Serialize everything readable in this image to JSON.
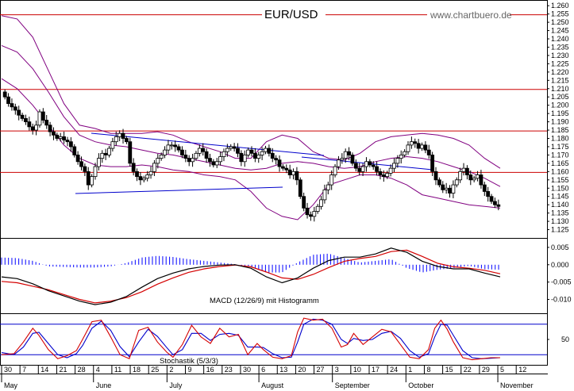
{
  "chart_data": [
    {
      "type": "candlestick",
      "title": "EUR/USD",
      "source": "www.chartbuero.de",
      "ylim": [
        1.12,
        1.262
      ],
      "yticks": [
        1.125,
        1.13,
        1.135,
        1.14,
        1.145,
        1.15,
        1.155,
        1.16,
        1.165,
        1.17,
        1.175,
        1.18,
        1.185,
        1.19,
        1.195,
        1.2,
        1.205,
        1.21,
        1.215,
        1.22,
        1.225,
        1.23,
        1.235,
        1.24,
        1.245,
        1.25,
        1.255,
        1.26
      ],
      "ytick_labels": [
        "1.125",
        "1.130",
        "1.135",
        "1.140",
        "1.145",
        "1.150",
        "1.155",
        "1.160",
        "1.165",
        "1.170",
        "1.175",
        "1.180",
        "1.185",
        "1.190",
        "1.195",
        "1.200",
        "1.205",
        "1.210",
        "1.215",
        "1.220",
        "1.225",
        "1.230",
        "1.235",
        "1.240",
        "1.245",
        "1.250",
        "1.255",
        "1.260"
      ],
      "horizontal_levels": [
        1.2545,
        1.2095,
        1.1845,
        1.1595
      ],
      "closes": [
        1.205,
        1.201,
        1.199,
        1.197,
        1.194,
        1.192,
        1.19,
        1.187,
        1.185,
        1.188,
        1.196,
        1.191,
        1.188,
        1.184,
        1.182,
        1.18,
        1.181,
        1.179,
        1.178,
        1.175,
        1.17,
        1.166,
        1.163,
        1.16,
        1.152,
        1.157,
        1.163,
        1.168,
        1.171,
        1.17,
        1.174,
        1.178,
        1.181,
        1.183,
        1.18,
        1.178,
        1.165,
        1.16,
        1.157,
        1.155,
        1.156,
        1.158,
        1.16,
        1.165,
        1.168,
        1.17,
        1.173,
        1.176,
        1.176,
        1.175,
        1.173,
        1.17,
        1.168,
        1.166,
        1.168,
        1.171,
        1.174,
        1.172,
        1.168,
        1.166,
        1.164,
        1.166,
        1.169,
        1.172,
        1.174,
        1.175,
        1.174,
        1.171,
        1.166,
        1.17,
        1.173,
        1.171,
        1.168,
        1.17,
        1.172,
        1.174,
        1.171,
        1.168,
        1.167,
        1.163,
        1.162,
        1.161,
        1.158,
        1.16,
        1.155,
        1.145,
        1.138,
        1.134,
        1.133,
        1.136,
        1.139,
        1.143,
        1.149,
        1.152,
        1.158,
        1.163,
        1.167,
        1.168,
        1.172,
        1.17,
        1.165,
        1.162,
        1.16,
        1.163,
        1.166,
        1.164,
        1.163,
        1.16,
        1.158,
        1.157,
        1.159,
        1.162,
        1.165,
        1.168,
        1.17,
        1.172,
        1.176,
        1.178,
        1.177,
        1.174,
        1.176,
        1.173,
        1.17,
        1.16,
        1.155,
        1.152,
        1.149,
        1.15,
        1.147,
        1.152,
        1.155,
        1.16,
        1.162,
        1.158,
        1.155,
        1.156,
        1.158,
        1.152,
        1.148,
        1.145,
        1.142,
        1.14,
        1.139
      ],
      "bollinger_upper": [
        [
          0,
          1.254
        ],
        [
          10,
          1.252
        ],
        [
          20,
          1.241
        ],
        [
          30,
          1.221
        ],
        [
          40,
          1.201
        ],
        [
          50,
          1.188
        ],
        [
          60,
          1.186
        ],
        [
          70,
          1.183
        ],
        [
          80,
          1.183
        ],
        [
          90,
          1.183
        ],
        [
          100,
          1.184
        ],
        [
          110,
          1.182
        ],
        [
          120,
          1.178
        ],
        [
          130,
          1.175
        ],
        [
          140,
          1.172
        ],
        [
          150,
          1.168
        ],
        [
          160,
          1.168
        ],
        [
          170,
          1.178
        ],
        [
          180,
          1.182
        ],
        [
          190,
          1.18
        ],
        [
          200,
          1.172
        ],
        [
          210,
          1.168
        ],
        [
          220,
          1.167
        ],
        [
          230,
          1.171
        ],
        [
          240,
          1.178
        ],
        [
          250,
          1.181
        ],
        [
          260,
          1.182
        ],
        [
          270,
          1.183
        ],
        [
          280,
          1.182
        ],
        [
          290,
          1.18
        ],
        [
          300,
          1.176
        ],
        [
          310,
          1.168
        ],
        [
          320,
          1.162
        ]
      ],
      "bollinger_mid": [
        [
          0,
          1.236
        ],
        [
          10,
          1.232
        ],
        [
          20,
          1.222
        ],
        [
          30,
          1.208
        ],
        [
          40,
          1.193
        ],
        [
          50,
          1.182
        ],
        [
          60,
          1.178
        ],
        [
          70,
          1.176
        ],
        [
          80,
          1.175
        ],
        [
          90,
          1.173
        ],
        [
          100,
          1.171
        ],
        [
          110,
          1.17
        ],
        [
          120,
          1.168
        ],
        [
          130,
          1.166
        ],
        [
          140,
          1.164
        ],
        [
          150,
          1.162
        ],
        [
          160,
          1.161
        ],
        [
          170,
          1.162
        ],
        [
          180,
          1.165
        ],
        [
          190,
          1.166
        ],
        [
          200,
          1.165
        ],
        [
          210,
          1.163
        ],
        [
          220,
          1.162
        ],
        [
          230,
          1.163
        ],
        [
          240,
          1.166
        ],
        [
          250,
          1.168
        ],
        [
          260,
          1.169
        ],
        [
          270,
          1.168
        ],
        [
          280,
          1.166
        ],
        [
          290,
          1.163
        ],
        [
          300,
          1.16
        ],
        [
          310,
          1.156
        ],
        [
          320,
          1.151
        ]
      ],
      "bollinger_lower": [
        [
          0,
          1.216
        ],
        [
          10,
          1.21
        ],
        [
          20,
          1.2
        ],
        [
          30,
          1.188
        ],
        [
          40,
          1.176
        ],
        [
          50,
          1.168
        ],
        [
          60,
          1.164
        ],
        [
          70,
          1.163
        ],
        [
          80,
          1.163
        ],
        [
          90,
          1.164
        ],
        [
          100,
          1.163
        ],
        [
          110,
          1.161
        ],
        [
          120,
          1.16
        ],
        [
          130,
          1.158
        ],
        [
          140,
          1.157
        ],
        [
          150,
          1.155
        ],
        [
          160,
          1.148
        ],
        [
          170,
          1.138
        ],
        [
          180,
          1.133
        ],
        [
          190,
          1.131
        ],
        [
          200,
          1.14
        ],
        [
          210,
          1.152
        ],
        [
          220,
          1.155
        ],
        [
          230,
          1.158
        ],
        [
          240,
          1.158
        ],
        [
          250,
          1.156
        ],
        [
          260,
          1.152
        ],
        [
          270,
          1.146
        ],
        [
          280,
          1.144
        ],
        [
          290,
          1.142
        ],
        [
          300,
          1.14
        ],
        [
          310,
          1.139
        ],
        [
          320,
          1.138
        ]
      ]
    },
    {
      "type": "macd",
      "label": "MACD (12/26/9) mit Histogramm",
      "ylim": [
        -0.014,
        0.0075
      ],
      "yticks": [
        0.005,
        0.0,
        -0.005,
        -0.01
      ],
      "ytick_labels": [
        "0.005",
        "0.000",
        "-0.005",
        "-0.010"
      ],
      "macd": [
        [
          0,
          -0.0035
        ],
        [
          10,
          -0.004
        ],
        [
          20,
          -0.0055
        ],
        [
          30,
          -0.0075
        ],
        [
          40,
          -0.009
        ],
        [
          50,
          -0.0105
        ],
        [
          60,
          -0.0115
        ],
        [
          70,
          -0.0108
        ],
        [
          80,
          -0.0092
        ],
        [
          90,
          -0.0065
        ],
        [
          100,
          -0.004
        ],
        [
          110,
          -0.0024
        ],
        [
          120,
          -0.0012
        ],
        [
          130,
          -0.0005
        ],
        [
          140,
          -0.0001
        ],
        [
          150,
          0.0
        ],
        [
          160,
          -0.001
        ],
        [
          170,
          -0.0035
        ],
        [
          180,
          -0.0052
        ],
        [
          190,
          -0.0038
        ],
        [
          200,
          -0.001
        ],
        [
          210,
          0.0012
        ],
        [
          220,
          0.0022
        ],
        [
          230,
          0.0022
        ],
        [
          240,
          0.0031
        ],
        [
          250,
          0.0048
        ],
        [
          260,
          0.0036
        ],
        [
          270,
          0.001
        ],
        [
          280,
          -0.0005
        ],
        [
          290,
          -0.0012
        ],
        [
          300,
          -0.0012
        ],
        [
          310,
          -0.0024
        ],
        [
          320,
          -0.0035
        ]
      ],
      "signal": [
        [
          0,
          -0.0048
        ],
        [
          10,
          -0.0052
        ],
        [
          20,
          -0.0062
        ],
        [
          30,
          -0.0072
        ],
        [
          40,
          -0.0086
        ],
        [
          50,
          -0.01
        ],
        [
          60,
          -0.011
        ],
        [
          70,
          -0.0105
        ],
        [
          80,
          -0.0095
        ],
        [
          90,
          -0.0078
        ],
        [
          100,
          -0.0056
        ],
        [
          110,
          -0.0038
        ],
        [
          120,
          -0.0022
        ],
        [
          130,
          -0.0012
        ],
        [
          140,
          -0.0005
        ],
        [
          150,
          -0.0001
        ],
        [
          160,
          -0.0006
        ],
        [
          170,
          -0.0021
        ],
        [
          180,
          -0.0038
        ],
        [
          190,
          -0.0042
        ],
        [
          200,
          -0.0028
        ],
        [
          210,
          -0.0008
        ],
        [
          220,
          0.001
        ],
        [
          230,
          0.0018
        ],
        [
          240,
          0.0024
        ],
        [
          250,
          0.0038
        ],
        [
          260,
          0.0042
        ],
        [
          270,
          0.0024
        ],
        [
          280,
          0.0004
        ],
        [
          290,
          -0.0006
        ],
        [
          300,
          -0.001
        ],
        [
          310,
          -0.0016
        ],
        [
          320,
          -0.0026
        ]
      ]
    },
    {
      "type": "stochastic",
      "label": "Stochastik (5/3/3)",
      "ylim": [
        0,
        100
      ],
      "yticks": [
        50
      ],
      "ytick_labels": [
        "50"
      ],
      "levels": [
        80,
        20
      ],
      "k": [
        [
          0,
          20
        ],
        [
          8,
          22
        ],
        [
          14,
          45
        ],
        [
          20,
          72
        ],
        [
          24,
          58
        ],
        [
          30,
          30
        ],
        [
          36,
          12
        ],
        [
          42,
          18
        ],
        [
          48,
          28
        ],
        [
          52,
          50
        ],
        [
          58,
          85
        ],
        [
          64,
          88
        ],
        [
          70,
          55
        ],
        [
          76,
          20
        ],
        [
          82,
          12
        ],
        [
          88,
          68
        ],
        [
          94,
          74
        ],
        [
          100,
          45
        ],
        [
          106,
          25
        ],
        [
          110,
          15
        ],
        [
          116,
          40
        ],
        [
          122,
          78
        ],
        [
          128,
          55
        ],
        [
          134,
          42
        ],
        [
          140,
          72
        ],
        [
          146,
          55
        ],
        [
          152,
          60
        ],
        [
          158,
          20
        ],
        [
          164,
          42
        ],
        [
          168,
          30
        ],
        [
          174,
          15
        ],
        [
          180,
          12
        ],
        [
          186,
          18
        ],
        [
          190,
          65
        ],
        [
          194,
          92
        ],
        [
          200,
          88
        ],
        [
          206,
          90
        ],
        [
          212,
          72
        ],
        [
          218,
          35
        ],
        [
          222,
          40
        ],
        [
          226,
          62
        ],
        [
          232,
          40
        ],
        [
          238,
          55
        ],
        [
          244,
          70
        ],
        [
          250,
          65
        ],
        [
          256,
          40
        ],
        [
          262,
          15
        ],
        [
          268,
          12
        ],
        [
          274,
          30
        ],
        [
          278,
          72
        ],
        [
          282,
          88
        ],
        [
          286,
          70
        ],
        [
          290,
          45
        ],
        [
          296,
          14
        ],
        [
          302,
          10
        ],
        [
          308,
          12
        ],
        [
          314,
          14
        ],
        [
          320,
          14
        ]
      ],
      "d": [
        [
          0,
          24
        ],
        [
          8,
          20
        ],
        [
          14,
          35
        ],
        [
          20,
          62
        ],
        [
          24,
          64
        ],
        [
          30,
          42
        ],
        [
          36,
          20
        ],
        [
          42,
          14
        ],
        [
          48,
          22
        ],
        [
          52,
          38
        ],
        [
          58,
          72
        ],
        [
          64,
          86
        ],
        [
          70,
          68
        ],
        [
          76,
          36
        ],
        [
          82,
          16
        ],
        [
          88,
          45
        ],
        [
          94,
          70
        ],
        [
          100,
          56
        ],
        [
          106,
          34
        ],
        [
          110,
          20
        ],
        [
          116,
          30
        ],
        [
          122,
          62
        ],
        [
          128,
          62
        ],
        [
          134,
          48
        ],
        [
          140,
          60
        ],
        [
          146,
          62
        ],
        [
          152,
          58
        ],
        [
          158,
          35
        ],
        [
          164,
          35
        ],
        [
          168,
          34
        ],
        [
          174,
          22
        ],
        [
          180,
          14
        ],
        [
          186,
          15
        ],
        [
          190,
          45
        ],
        [
          194,
          80
        ],
        [
          200,
          90
        ],
        [
          206,
          88
        ],
        [
          212,
          80
        ],
        [
          218,
          50
        ],
        [
          222,
          42
        ],
        [
          226,
          52
        ],
        [
          232,
          48
        ],
        [
          238,
          50
        ],
        [
          244,
          62
        ],
        [
          250,
          66
        ],
        [
          256,
          52
        ],
        [
          262,
          28
        ],
        [
          268,
          15
        ],
        [
          274,
          22
        ],
        [
          278,
          55
        ],
        [
          282,
          80
        ],
        [
          286,
          78
        ],
        [
          290,
          58
        ],
        [
          296,
          28
        ],
        [
          302,
          14
        ],
        [
          308,
          12
        ],
        [
          314,
          13
        ],
        [
          320,
          14
        ]
      ]
    }
  ],
  "x_axis": {
    "day_ticks": [
      "30",
      "7",
      "14",
      "21",
      "28",
      "4",
      "11",
      "18",
      "25",
      "2",
      "9",
      "16",
      "23",
      "30",
      "6",
      "13",
      "20",
      "27",
      "3",
      "10",
      "17",
      "24",
      "1",
      "8",
      "15",
      "22",
      "29",
      "5",
      "12"
    ],
    "month_labels": [
      "May",
      "June",
      "July",
      "August",
      "September",
      "October",
      "November"
    ]
  },
  "colors": {
    "up_candle": "#ffffff",
    "down_candle": "#000000",
    "bollinger": "#800080",
    "trendline": "#0000cc",
    "level_line": "#cc0000",
    "macd_line": "#000000",
    "signal_line": "#d40000",
    "histogram": "#1a1aff"
  }
}
